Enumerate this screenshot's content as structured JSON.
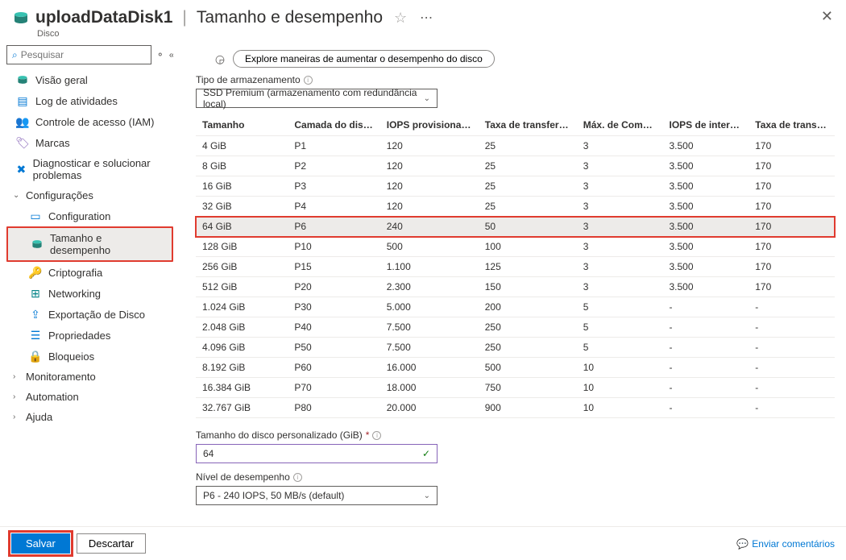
{
  "header": {
    "resource_name": "uploadDataDisk1",
    "page_title": "Tamanho e desempenho",
    "resource_type": "Disco"
  },
  "search": {
    "placeholder": "Pesquisar"
  },
  "sidebar": {
    "items": [
      {
        "label": "Visão geral"
      },
      {
        "label": "Log de atividades"
      },
      {
        "label": "Controle de acesso (IAM)"
      },
      {
        "label": "Marcas"
      },
      {
        "label": "Diagnosticar e solucionar problemas"
      }
    ],
    "groups": {
      "config": {
        "label": "Configurações",
        "items": [
          {
            "label": "Configuration"
          },
          {
            "label": "Tamanho e desempenho",
            "selected": true
          },
          {
            "label": "Criptografia"
          },
          {
            "label": "Networking"
          },
          {
            "label": "Exportação de Disco"
          },
          {
            "label": "Propriedades"
          },
          {
            "label": "Bloqueios"
          }
        ]
      },
      "monitor": {
        "label": "Monitoramento"
      },
      "automation": {
        "label": "Automation"
      },
      "help": {
        "label": "Ajuda"
      }
    }
  },
  "main": {
    "explore_label": "Explore maneiras de aumentar o desempenho do disco",
    "storage_type_label": "Tipo de armazenamento",
    "storage_type_value": "SSD Premium (armazenamento com redundância local)",
    "custom_size_label": "Tamanho do disco personalizado (GiB)",
    "custom_size_value": "64",
    "perf_tier_label": "Nível de desempenho",
    "perf_tier_value": "P6 - 240 IOPS, 50 MB/s (default)"
  },
  "table": {
    "headers": {
      "size": "Tamanho",
      "tier": "Camada do disco",
      "iops": "IOPS provisionada",
      "throughput": "Taxa de transferênci...",
      "shares": "Máx. de Comparti...",
      "burst_iops": "IOPS de intermitê...",
      "burst_tp": "Taxa de transfer..."
    },
    "rows": [
      {
        "size": "4 GiB",
        "tier": "P1",
        "iops": "120",
        "tp": "25",
        "sh": "3",
        "biops": "3.500",
        "btp": "170"
      },
      {
        "size": "8 GiB",
        "tier": "P2",
        "iops": "120",
        "tp": "25",
        "sh": "3",
        "biops": "3.500",
        "btp": "170"
      },
      {
        "size": "16 GiB",
        "tier": "P3",
        "iops": "120",
        "tp": "25",
        "sh": "3",
        "biops": "3.500",
        "btp": "170"
      },
      {
        "size": "32 GiB",
        "tier": "P4",
        "iops": "120",
        "tp": "25",
        "sh": "3",
        "biops": "3.500",
        "btp": "170"
      },
      {
        "size": "64 GiB",
        "tier": "P6",
        "iops": "240",
        "tp": "50",
        "sh": "3",
        "biops": "3.500",
        "btp": "170",
        "selected": true
      },
      {
        "size": "128 GiB",
        "tier": "P10",
        "iops": "500",
        "tp": "100",
        "sh": "3",
        "biops": "3.500",
        "btp": "170"
      },
      {
        "size": "256 GiB",
        "tier": "P15",
        "iops": "1.100",
        "tp": "125",
        "sh": "3",
        "biops": "3.500",
        "btp": "170"
      },
      {
        "size": "512 GiB",
        "tier": "P20",
        "iops": "2.300",
        "tp": "150",
        "sh": "3",
        "biops": "3.500",
        "btp": "170"
      },
      {
        "size": "1.024 GiB",
        "tier": "P30",
        "iops": "5.000",
        "tp": "200",
        "sh": "5",
        "biops": "-",
        "btp": "-"
      },
      {
        "size": "2.048 GiB",
        "tier": "P40",
        "iops": "7.500",
        "tp": "250",
        "sh": "5",
        "biops": "-",
        "btp": "-"
      },
      {
        "size": "4.096 GiB",
        "tier": "P50",
        "iops": "7.500",
        "tp": "250",
        "sh": "5",
        "biops": "-",
        "btp": "-"
      },
      {
        "size": "8.192 GiB",
        "tier": "P60",
        "iops": "16.000",
        "tp": "500",
        "sh": "10",
        "biops": "-",
        "btp": "-"
      },
      {
        "size": "16.384 GiB",
        "tier": "P70",
        "iops": "18.000",
        "tp": "750",
        "sh": "10",
        "biops": "-",
        "btp": "-"
      },
      {
        "size": "32.767 GiB",
        "tier": "P80",
        "iops": "20.000",
        "tp": "900",
        "sh": "10",
        "biops": "-",
        "btp": "-"
      }
    ]
  },
  "footer": {
    "save": "Salvar",
    "discard": "Descartar",
    "feedback": "Enviar comentários"
  }
}
